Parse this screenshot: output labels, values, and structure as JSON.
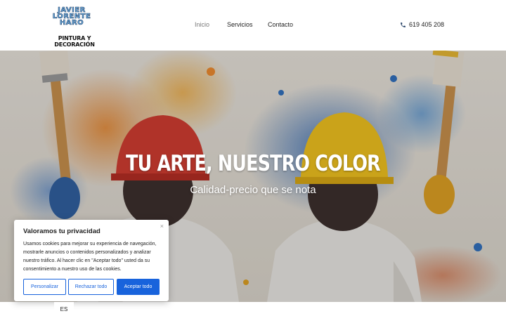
{
  "logo": {
    "line1": "JAVIER LORENTE HARO",
    "line2": "PINTURA Y DECORACIÓN"
  },
  "nav": {
    "items": [
      "Inicio",
      "Servicios",
      "Contacto"
    ],
    "active": "Inicio"
  },
  "phone": {
    "icon": "phone-icon",
    "number": "619 405 208"
  },
  "hero": {
    "title": "TU ARTE, NUESTRO COLOR",
    "subtitle": "Calidad-precio que se nota"
  },
  "cookie": {
    "title": "Valoramos tu privacidad",
    "close_icon": "×",
    "text": "Usamos cookies para mejorar su experiencia de navegación, mostrarle anuncios o contenidos personalizados y analizar nuestro tráfico. Al hacer clic en \"Aceptar todo\" usted da su consentimiento a nuestro uso de las cookies.",
    "buttons": {
      "customize": "Personalizar",
      "reject": "Rechazar todo",
      "accept": "Aceptar todo"
    }
  },
  "language": "ES",
  "colors": {
    "accent": "#1863dc",
    "nav_active": "#7a7a7a",
    "text": "#1e1e1e"
  }
}
